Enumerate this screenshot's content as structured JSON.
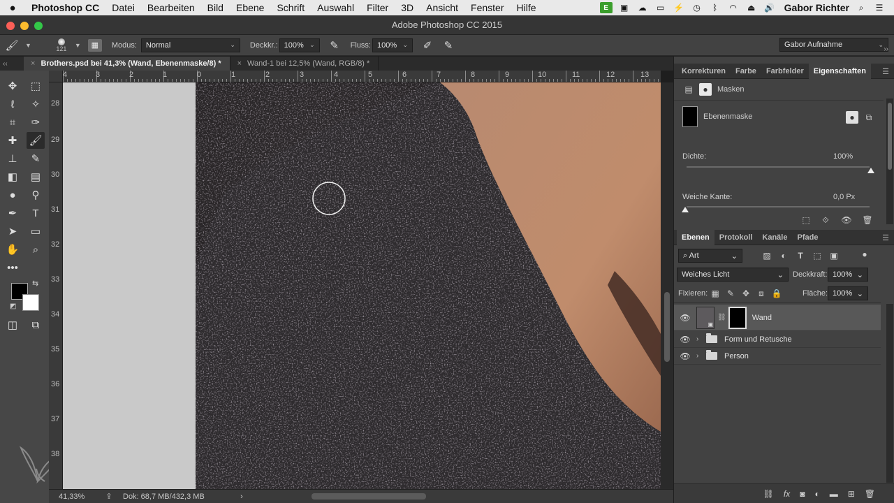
{
  "menubar": {
    "app_name": "Photoshop CC",
    "items": [
      "Datei",
      "Bearbeiten",
      "Bild",
      "Ebene",
      "Schrift",
      "Auswahl",
      "Filter",
      "3D",
      "Ansicht",
      "Fenster",
      "Hilfe"
    ],
    "user_name": "Gabor Richter"
  },
  "window": {
    "title": "Adobe Photoshop CC 2015"
  },
  "options": {
    "brush_size": "121",
    "mode_label": "Modus:",
    "mode_value": "Normal",
    "opacity_label": "Deckkr.:",
    "opacity_value": "100%",
    "flow_label": "Fluss:",
    "flow_value": "100%",
    "workspace_value": "Gabor Aufnahme"
  },
  "documents": {
    "tabs": [
      {
        "label": "Brothers.psd bei 41,3% (Wand, Ebenenmaske/8) *",
        "active": true
      },
      {
        "label": "Wand-1 bei 12,5% (Wand, RGB/8) *",
        "active": false
      }
    ]
  },
  "rulers": {
    "top": [
      "4",
      "3",
      "2",
      "1",
      "0",
      "1",
      "2",
      "3",
      "4",
      "5",
      "6",
      "7",
      "8",
      "9",
      "10",
      "11",
      "12",
      "13"
    ],
    "left": [
      "28",
      "29",
      "30",
      "31",
      "32",
      "33",
      "34",
      "35",
      "36",
      "37",
      "38"
    ]
  },
  "status": {
    "zoom": "41,33%",
    "doc_size": "Dok: 68,7 MB/432,3 MB"
  },
  "properties_panel": {
    "tabs": [
      "Korrekturen",
      "Farbe",
      "Farbfelder",
      "Eigenschaften"
    ],
    "active_tab": "Eigenschaften",
    "section_title": "Masken",
    "mask_name": "Ebenenmaske",
    "density_label": "Dichte:",
    "density_value": "100%",
    "feather_label": "Weiche Kante:",
    "feather_value": "0,0 Px"
  },
  "layers_panel": {
    "tabs": [
      "Ebenen",
      "Protokoll",
      "Kanäle",
      "Pfade"
    ],
    "active_tab": "Ebenen",
    "filter_value": "Art",
    "blend_mode": "Weiches Licht",
    "opacity_label": "Deckkraft:",
    "opacity_value": "100%",
    "lock_label": "Fixieren:",
    "fill_label": "Fläche:",
    "fill_value": "100%",
    "layers": [
      {
        "name": "Wand",
        "type": "layer",
        "selected": true
      },
      {
        "name": "Form und Retusche",
        "type": "group"
      },
      {
        "name": "Person",
        "type": "group"
      }
    ]
  },
  "colors": {
    "accent_tab": "#424242",
    "foreground": "#000000",
    "background": "#ffffff"
  }
}
